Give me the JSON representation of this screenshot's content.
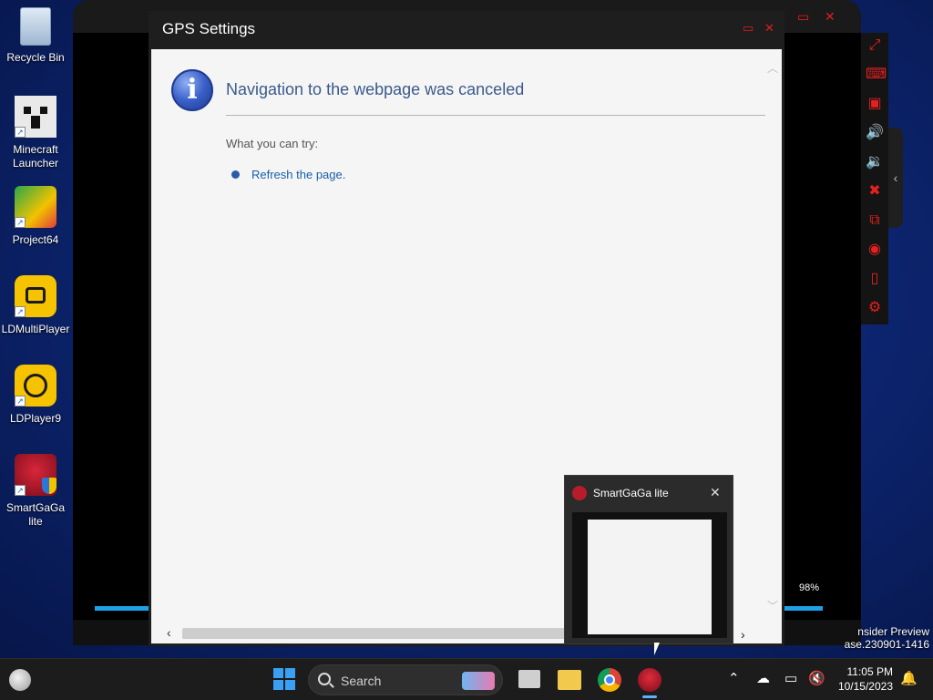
{
  "desktop": {
    "icons": [
      {
        "label": "Recycle Bin"
      },
      {
        "label": "Minecraft Launcher"
      },
      {
        "label": "Project64"
      },
      {
        "label": "LDMultiPlayer"
      },
      {
        "label": "LDPlayer9"
      },
      {
        "label": "SmartGaGa lite"
      }
    ],
    "watermark_line1": "nsider Preview",
    "watermark_line2": "ase.230901-1416"
  },
  "emulator": {
    "zoom_label": "98%",
    "toolbar_icons": [
      "fullscreen-icon",
      "keyboard-icon",
      "screen-record-icon",
      "volume-up-icon",
      "volume-down-icon",
      "close-app-icon",
      "multi-instance-icon",
      "location-icon",
      "shake-icon",
      "settings-icon"
    ],
    "accent_color": "#e21d1d"
  },
  "gps_dialog": {
    "title": "GPS Settings",
    "heading": "Navigation to the webpage was canceled",
    "try_label": "What you can try:",
    "refresh_link": "Refresh the page."
  },
  "thumbnail": {
    "title": "SmartGaGa lite"
  },
  "taskbar": {
    "search_label": "Search",
    "time": "11:05 PM",
    "date": "10/15/2023"
  }
}
